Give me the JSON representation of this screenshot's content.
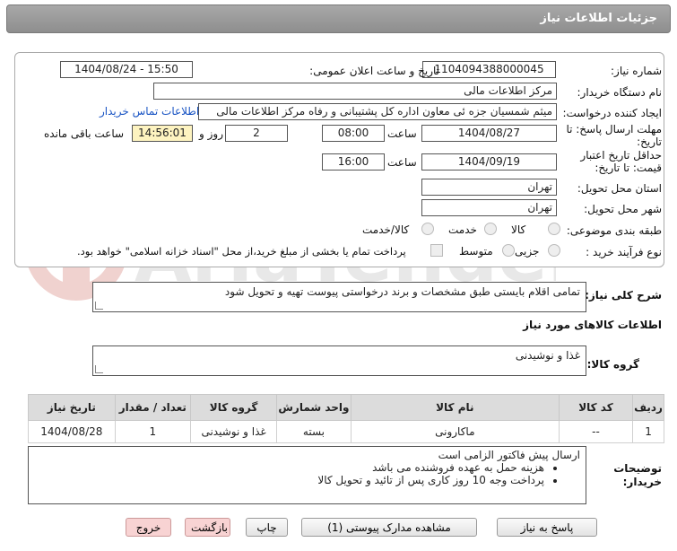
{
  "header": {
    "title": "جزئیات اطلاعات نیاز"
  },
  "form": {
    "need_number_label": "شماره نیاز:",
    "need_number": "1104094388000045",
    "announce_label": "تاریخ و ساعت اعلان عمومی:",
    "announce_value": "1404/08/24 - 15:50",
    "buyer_org_label": "نام دستگاه خریدار:",
    "buyer_org": "مرکز اطلاعات مالی",
    "creator_label": "ایجاد کننده درخواست:",
    "creator": "میثم شمسیان جزه ئی معاون اداره کل پشتیبانی و رفاه مرکز اطلاعات مالی",
    "contact_link": "اطلاعات تماس خریدار",
    "deadline_label_1": "مهلت ارسال پاسخ: تا",
    "deadline_label_2": "تاریخ:",
    "deadline_date": "1404/08/27",
    "time_label": "ساعت",
    "deadline_time": "08:00",
    "days_value": "2",
    "days_label": "روز و",
    "remaining_time": "14:56:01",
    "remaining_label": "ساعت باقی مانده",
    "validity_label_1": "حداقل تاریخ اعتبار",
    "validity_label_2": "قیمت: تا تاریخ:",
    "validity_date": "1404/09/19",
    "validity_time": "16:00",
    "province_label": "استان محل تحویل:",
    "province": "تهران",
    "city_label": "شهر محل تحویل:",
    "city": "تهران",
    "category_label": "طبقه بندی موضوعی:",
    "category_options": [
      "کالا",
      "خدمت",
      "کالا/خدمت"
    ],
    "process_label": "نوع فرآیند خرید :",
    "process_options": [
      "جزیی",
      "متوسط"
    ],
    "payment_text": "پرداخت تمام یا بخشی از مبلغ خرید،از محل \"اسناد خزانه اسلامی\" خواهد بود."
  },
  "description": {
    "label": "شرح کلی نیاز:",
    "text": "تمامی اقلام بایستی طبق مشخصات و برند درخواستی پیوست تهیه و تحویل شود"
  },
  "goods_section": {
    "title": "اطلاعات کالاهای مورد نیاز",
    "group_label": "گروه کالا:",
    "group_value": "غذا و نوشیدنی"
  },
  "table": {
    "headers": [
      "ردیف",
      "کد کالا",
      "نام کالا",
      "واحد شمارش",
      "گروه کالا",
      "تعداد / مقدار",
      "تاریخ نیاز"
    ],
    "rows": [
      [
        "1",
        "--",
        "ماکارونی",
        "بسته",
        "غذا و نوشیدنی",
        "1",
        "1404/08/28"
      ]
    ]
  },
  "buyer_notes": {
    "label_1": "توضیحات",
    "label_2": "خریدار:",
    "first_line": "ارسال پیش فاکتور الزامی است",
    "bullets": [
      "هزینه حمل به عهده فروشنده می باشد",
      "پرداخت وجه 10 روز کاری پس از تائید و تحویل کالا"
    ]
  },
  "buttons": {
    "reply": "پاسخ به نیاز",
    "attachments": "مشاهده مدارک پیوستی (1)",
    "print": "چاپ",
    "back": "بازگشت",
    "exit": "خروج"
  },
  "colors": {
    "header": "#999999",
    "link": "#1a55c4",
    "remaining_bg": "#fdf3c0",
    "exit_bg": "#f8d3d3"
  }
}
